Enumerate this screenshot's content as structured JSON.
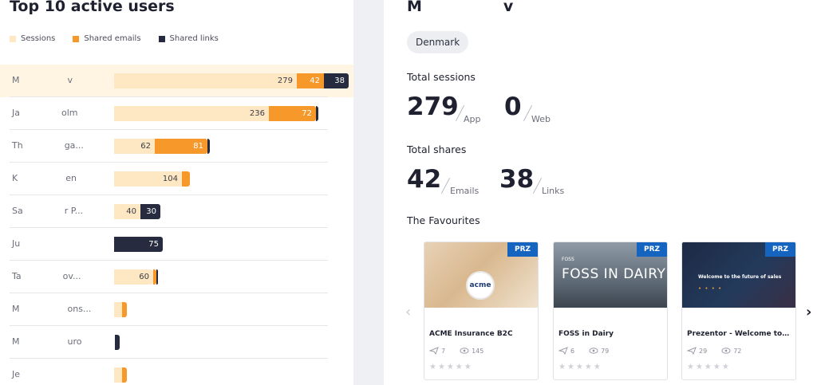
{
  "left_panel": {
    "title": "Top 10 active users",
    "legend": [
      {
        "label": "Sessions",
        "color": "#fde8c3"
      },
      {
        "label": "Shared emails",
        "color": "#f7982b"
      },
      {
        "label": "Shared links",
        "color": "#262b3f"
      }
    ],
    "users": [
      {
        "name": "M",
        "name_tail": "v",
        "sessions": 279,
        "emails": 42,
        "links": 38,
        "active": true
      },
      {
        "name": "Ja",
        "name_tail": "olm",
        "sessions": 236,
        "emails": 72,
        "links": 0
      },
      {
        "name": "Th",
        "name_tail": "ga...",
        "sessions": 62,
        "emails": 81,
        "links": 0
      },
      {
        "name": "K",
        "name_tail": "en",
        "sessions": 104,
        "emails": 0,
        "links": 0
      },
      {
        "name": "Sa",
        "name_tail": "r P...",
        "sessions": 40,
        "emails": 0,
        "links": 30
      },
      {
        "name": "Ju",
        "name_tail": "",
        "sessions": 0,
        "emails": 0,
        "links": 75
      },
      {
        "name": "Ta",
        "name_tail": "ov...",
        "sessions": 60,
        "emails": 0,
        "links": 0
      },
      {
        "name": "M",
        "name_tail": "ons...",
        "sessions": 0,
        "emails": 0,
        "links": 0
      },
      {
        "name": "M",
        "name_tail": "uro",
        "sessions": 0,
        "emails": 0,
        "links": 0
      },
      {
        "name": "Je",
        "name_tail": "",
        "sessions": 0,
        "emails": 0,
        "links": 0
      }
    ]
  },
  "right_panel": {
    "user_title_start": "M",
    "user_title_end": "v",
    "country": "Denmark",
    "total_sessions_label": "Total sessions",
    "app_sessions": "279",
    "app_label": "App",
    "web_sessions": "0",
    "web_label": "Web",
    "total_shares_label": "Total shares",
    "emails_count": "42",
    "emails_label": "Emails",
    "links_count": "38",
    "links_label": "Links",
    "favourites_label": "The Favourites",
    "favourites": [
      {
        "badge": "PRZ",
        "title": "ACME Insurance B2C",
        "shares": "7",
        "views": "145",
        "logo": "acme",
        "stars": "★★★★★"
      },
      {
        "badge": "PRZ",
        "title": "FOSS in Dairy",
        "shares": "6",
        "views": "79",
        "headline": "FOSS IN DAIRY",
        "brand": "FOSS",
        "stars": "★★★★★"
      },
      {
        "badge": "PRZ",
        "title": "Prezentor - Welcome to the ...",
        "shares": "29",
        "views": "72",
        "headline": "Welcome to the future of sales",
        "stars": "★★★★★"
      }
    ],
    "prev_arrow": "‹",
    "next_arrow": "›"
  },
  "colors": {
    "sessions": "#fde8c3",
    "emails": "#f7982b",
    "links": "#262b3f",
    "active_row": "#fff5e2",
    "badge": "#1565c0"
  }
}
